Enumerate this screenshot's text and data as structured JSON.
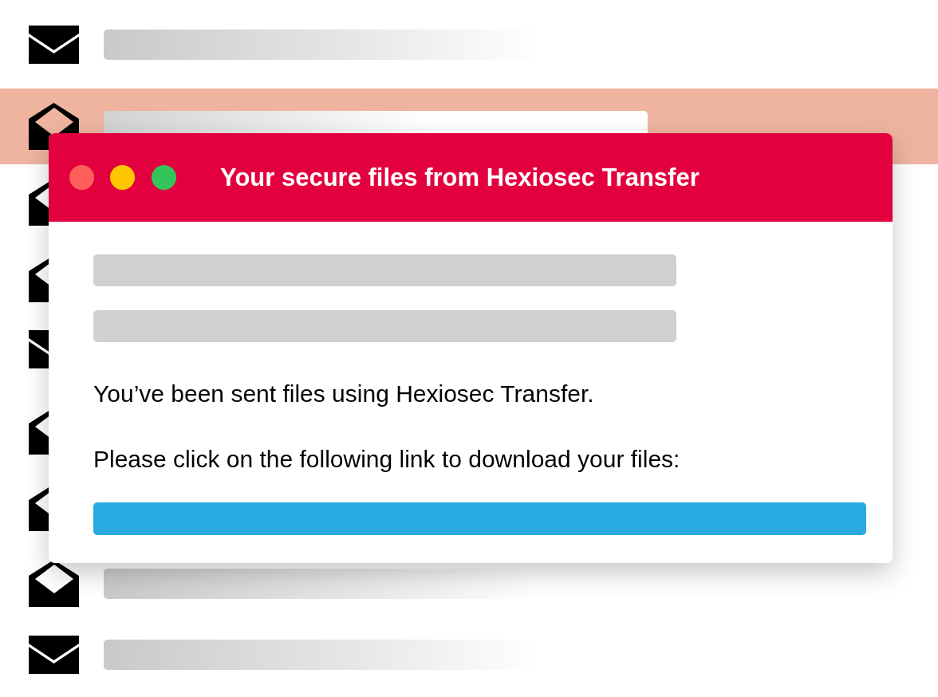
{
  "inbox": {
    "messages": [
      {
        "opened": false,
        "selected": false
      },
      {
        "opened": true,
        "selected": true
      },
      {
        "opened": true,
        "selected": false
      },
      {
        "opened": true,
        "selected": false
      },
      {
        "opened": false,
        "selected": false
      },
      {
        "opened": true,
        "selected": false
      },
      {
        "opened": true,
        "selected": false
      },
      {
        "opened": true,
        "selected": false
      },
      {
        "opened": false,
        "selected": false
      }
    ]
  },
  "email_window": {
    "title": "Your secure files from Hexiosec Transfer",
    "paragraphs": [
      "You’ve been sent files using Hexiosec Transfer.",
      "Please click on the following link to download your files:"
    ]
  }
}
